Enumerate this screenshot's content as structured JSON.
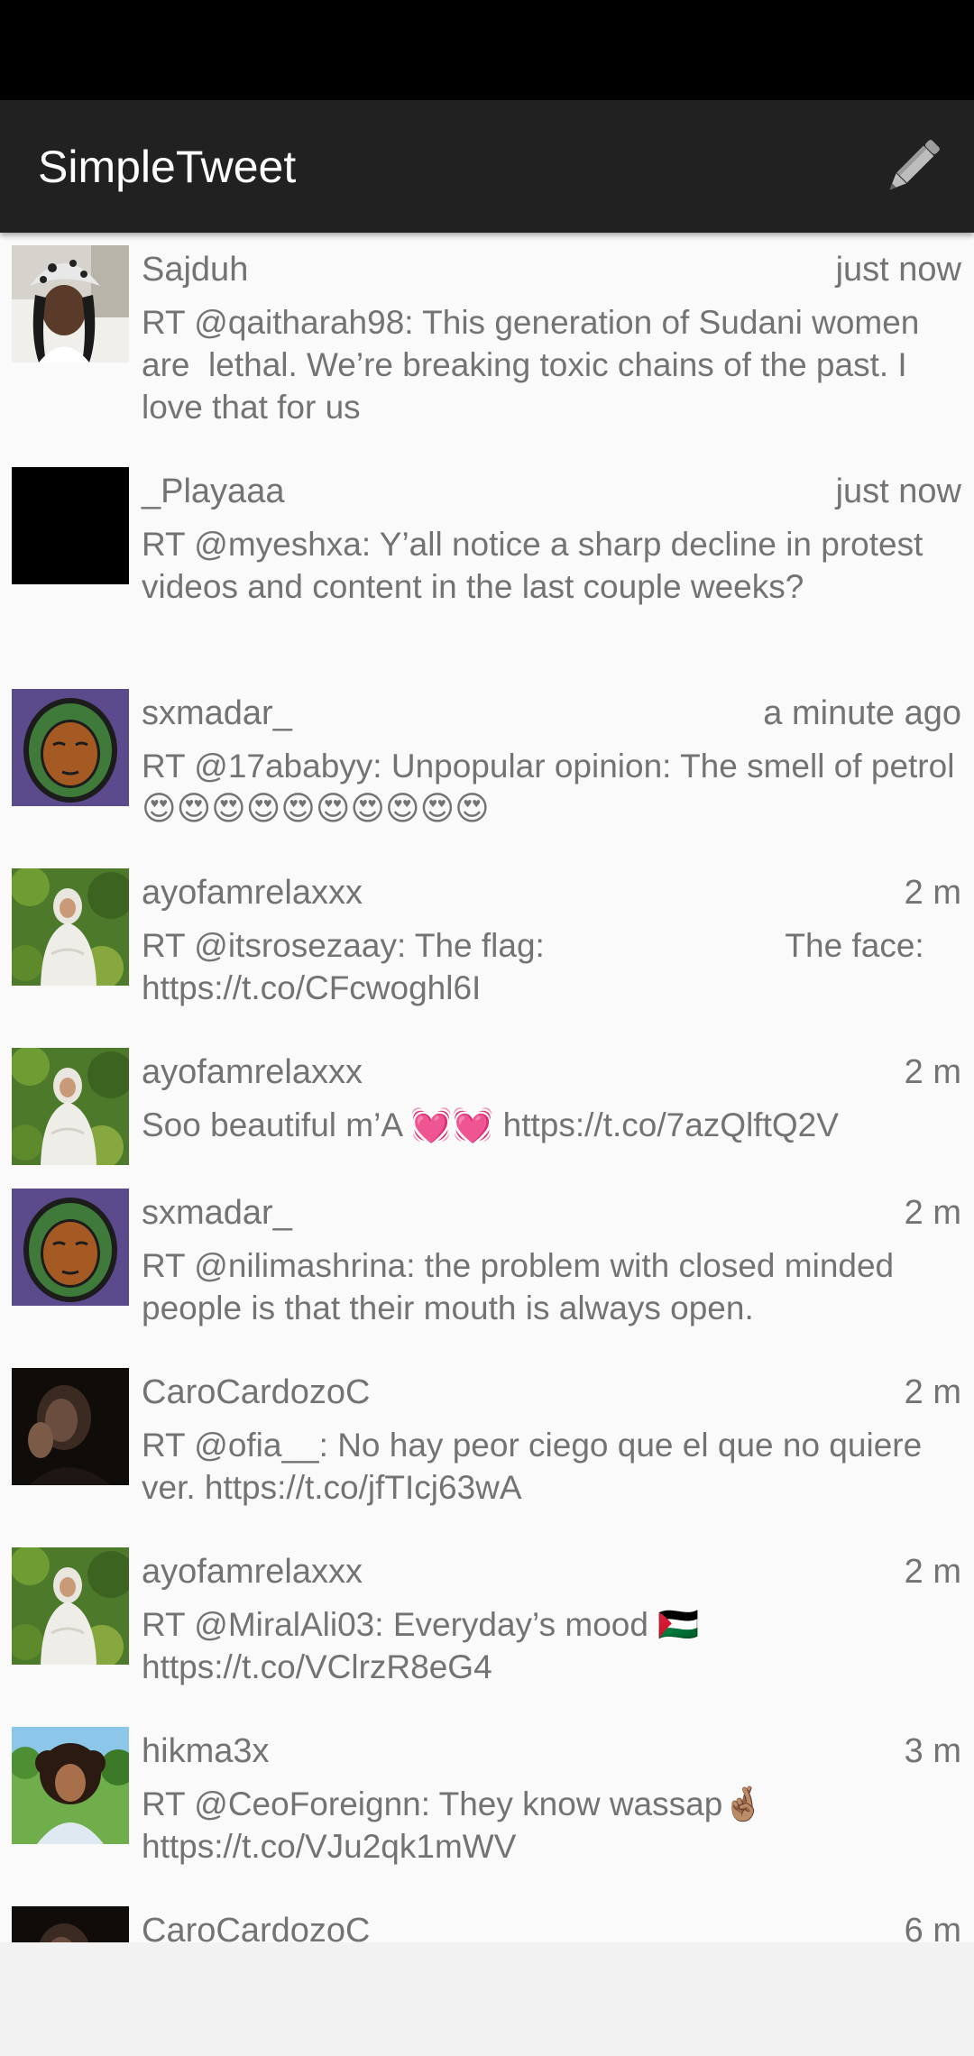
{
  "app": {
    "title": "SimpleTweet",
    "compose_icon": "pencil-icon"
  },
  "colors": {
    "status_bar": "#000000",
    "app_bar": "#212121",
    "title_text": "#ffffff",
    "secondary_text": "#737373",
    "list_background": "#fafafa"
  },
  "tweets": [
    {
      "user": "Sajduh",
      "time": "just now",
      "body": "RT @qaitharah98: This generation of Sudani women are  lethal. We’re breaking toxic chains of the past. I love that for us",
      "avatar": "bucket-hat-avatar"
    },
    {
      "user": "_Playaaa",
      "time": "just now",
      "body": "RT @myeshxa: Y’all notice a sharp decline in protest videos and content in the last couple weeks?",
      "avatar": "black-avatar"
    },
    {
      "user": "sxmadar_",
      "time": "a minute ago",
      "body": "RT @17ababyy: Unpopular opinion: The smell of petrol😍😍😍😍😍😍😍😍😍😍",
      "avatar": "hijab-cartoon-avatar"
    },
    {
      "user": "ayofamrelaxxx",
      "time": "2 m",
      "body": "RT @itsrosezaay: The flag:                          The face: https://t.co/CFcwoghl6I",
      "avatar": "garden-portrait-avatar"
    },
    {
      "user": "ayofamrelaxxx",
      "time": "2 m",
      "body": "Soo beautiful m’A 💓💓 https://t.co/7azQlftQ2V",
      "avatar": "garden-portrait-avatar"
    },
    {
      "user": "sxmadar_",
      "time": "2 m",
      "body": "RT @nilimashrina: the problem with closed minded people is that their mouth is always open.",
      "avatar": "hijab-cartoon-avatar"
    },
    {
      "user": "CaroCardozoC",
      "time": "2 m",
      "body": "RT @ofia__: No hay peor ciego que el que no quiere ver. https://t.co/jfTIcj63wA",
      "avatar": "dark-portrait-avatar"
    },
    {
      "user": "ayofamrelaxxx",
      "time": "2 m",
      "body": "RT @MiralAli03: Everyday’s mood 🇵🇸 https://t.co/VClrzR8eG4",
      "avatar": "garden-portrait-avatar"
    },
    {
      "user": "hikma3x",
      "time": "3 m",
      "body": "RT @CeoForeignn: They know wassap🤞🏽 https://t.co/VJu2qk1mWV",
      "avatar": "curly-hair-avatar"
    },
    {
      "user": "CaroCardozoC",
      "time": "6 m",
      "body": "",
      "avatar": "dark-portrait-avatar"
    }
  ]
}
